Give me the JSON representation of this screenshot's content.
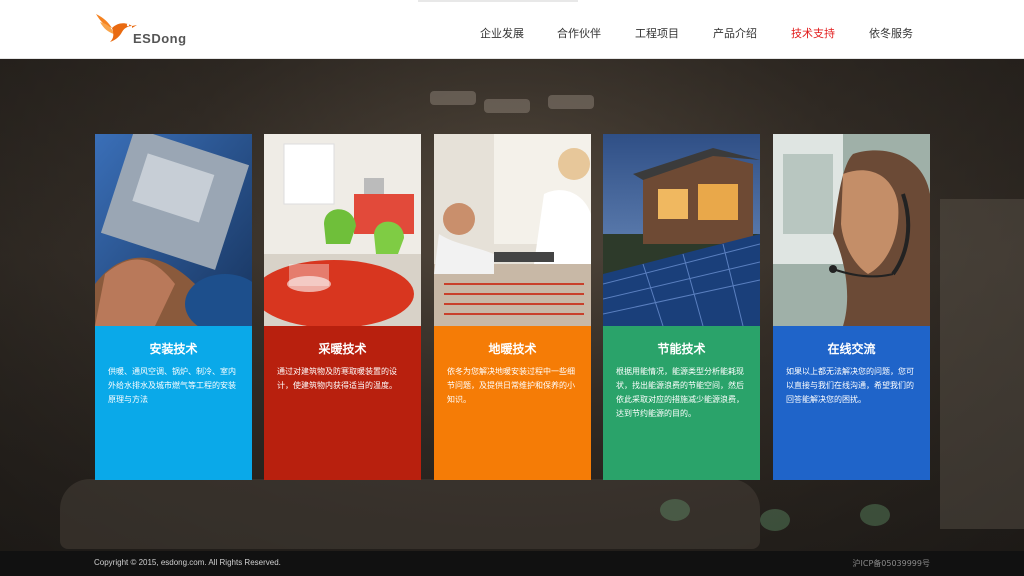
{
  "header": {
    "logo_text": "ESDong",
    "nav": [
      {
        "label": "企业发展",
        "active": false
      },
      {
        "label": "合作伙伴",
        "active": false
      },
      {
        "label": "工程项目",
        "active": false
      },
      {
        "label": "产品介绍",
        "active": false
      },
      {
        "label": "技术支持",
        "active": true
      },
      {
        "label": "依冬服务",
        "active": false
      }
    ],
    "active_color": "#e21b1b",
    "logo_icon": "bird-logo-icon"
  },
  "cards": [
    {
      "title": "安装技术",
      "desc": "供暖、通风空调、锅炉、制冷、室内外给水排水及城市燃气等工程的安装原理与方法",
      "color": "#0aa9e9",
      "image": "technician-installing-equipment"
    },
    {
      "title": "采暖技术",
      "desc": "通过对建筑物及防寒取暖装置的设计，使建筑物内获得适当的温度。",
      "color": "#b8200e",
      "image": "living-room-green-chairs"
    },
    {
      "title": "地暖技术",
      "desc": "依冬为您解决地暖安装过程中一些细节问题，及提供日常维护和保养的小知识。",
      "color": "#f57c06",
      "image": "couple-reviewing-floor-heating"
    },
    {
      "title": "节能技术",
      "desc": "根据用能情况，能源类型分析能耗现状，找出能源浪费的节能空间，然后依此采取对应的措施减少能源浪费，达到节约能源的目的。",
      "color": "#2aa36a",
      "image": "house-with-solar-panels"
    },
    {
      "title": "在线交流",
      "desc": "如果以上都无法解决您的问题，您可以直接与我们在线沟通，希望我们的回答能解决您的困扰。",
      "color": "#1f64c9",
      "image": "support-agent-with-headset"
    }
  ],
  "footer": {
    "copyright": "Copyright © 2015, esdong.com. All Rights Reserved.",
    "icp": "沪ICP备05039999号"
  }
}
